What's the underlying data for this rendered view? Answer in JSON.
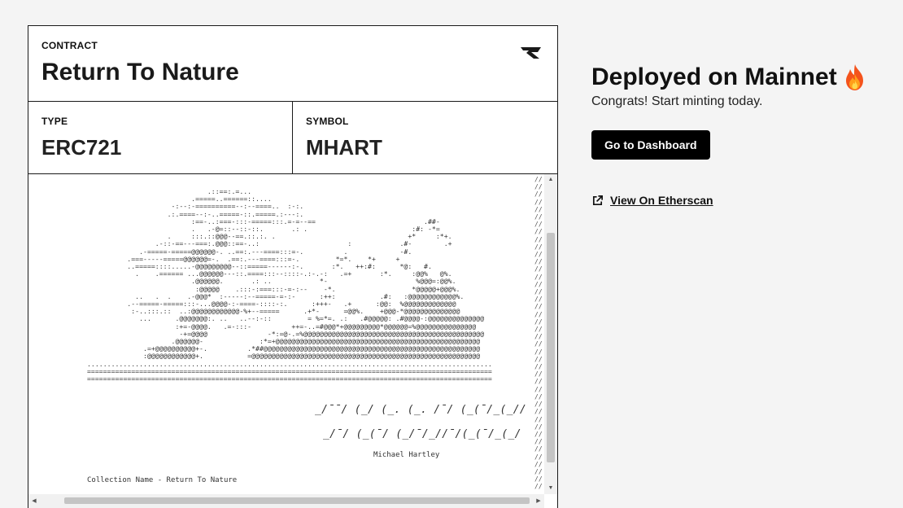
{
  "contract": {
    "label": "CONTRACT",
    "name": "Return To Nature"
  },
  "meta": {
    "type_label": "TYPE",
    "type_value": "ERC721",
    "symbol_label": "SYMBOL",
    "symbol_value": "MHART"
  },
  "artwork": {
    "signature_line1": "_/¯¯/ (_/ (_. (_. /¯/ (_(¯/_(_//",
    "signature_line2": "_/¯/ (_(¯/ (_/¯/_//¯/(_(¯/_(_/",
    "artist": "Michael Hartley",
    "collection": "Collection Name - Return To Nature"
  },
  "deployment": {
    "title": "Deployed on Mainnet",
    "subtitle": "Congrats! Start minting today.",
    "dashboard_button": "Go to Dashboard",
    "etherscan_link": "View On Etherscan"
  },
  "icons": {
    "brand": "brand-logo-icon",
    "fire": "fire-icon",
    "external": "external-link-icon"
  },
  "colors": {
    "button_bg": "#000000",
    "button_text": "#ffffff",
    "border": "#1a1a1a",
    "page_bg": "#f4f4f4"
  }
}
